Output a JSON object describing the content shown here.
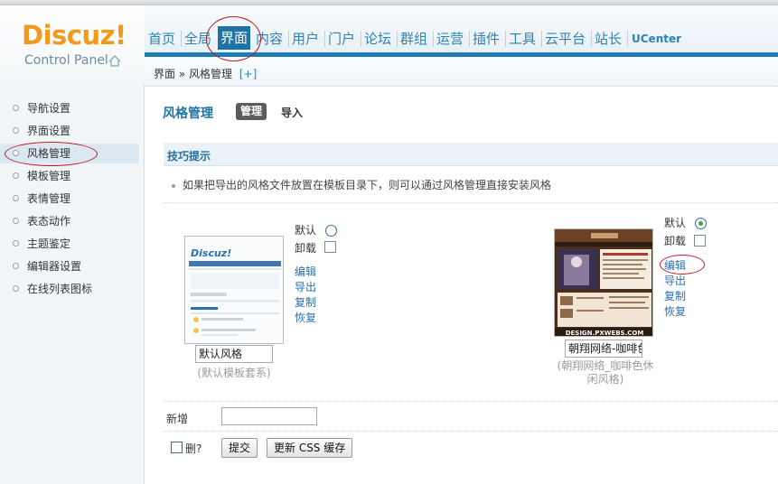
{
  "brand": {
    "name": "Discuz!",
    "subtitle": "Control Panel",
    "home_icon": "home-icon"
  },
  "nav": {
    "items": [
      "首页",
      "全局",
      "界面",
      "内容",
      "用户",
      "门户",
      "论坛",
      "群组",
      "运营",
      "插件",
      "工具",
      "云平台",
      "站长",
      "UCenter"
    ],
    "active": "界面"
  },
  "breadcrumb": {
    "section": "界面",
    "separator": "»",
    "page": "风格管理",
    "add": "[+]"
  },
  "sidebar": {
    "items": [
      "导航设置",
      "界面设置",
      "风格管理",
      "模板管理",
      "表情管理",
      "表态动作",
      "主题鉴定",
      "编辑器设置",
      "在线列表图标"
    ],
    "selected": "风格管理"
  },
  "main": {
    "title": "风格管理",
    "tabs": [
      "管理",
      "导入"
    ],
    "tips": {
      "heading": "技巧提示",
      "text": "如果把导出的风格文件放置在模板目录下，则可以通过风格管理直接安装风格"
    },
    "styles": [
      {
        "name_value": "默认风格",
        "template": "(默认模板套系)",
        "default_label": "默认",
        "uninstall_label": "卸载",
        "is_default": false,
        "actions": [
          "编辑",
          "导出",
          "复制",
          "恢复"
        ],
        "thumb_logo": "Discuz!"
      },
      {
        "name_value": "朝翔网络-咖啡色",
        "template_line1": "(朝翔网络_咖啡色休",
        "template_line2": "闲风格)",
        "default_label": "默认",
        "uninstall_label": "卸载",
        "is_default": true,
        "actions": [
          "编辑",
          "导出",
          "复制",
          "恢复"
        ],
        "thumb_watermark": "DESIGN.PXWEBS.COM"
      }
    ],
    "add": {
      "label": "新增",
      "value": ""
    },
    "delete_label": "删?",
    "submit_label": "提交",
    "refresh_css_label": "更新 CSS 缓存"
  },
  "colors": {
    "accent": "#1e73a5",
    "logo": "#f49a1a",
    "annotation": "#c0171f"
  }
}
